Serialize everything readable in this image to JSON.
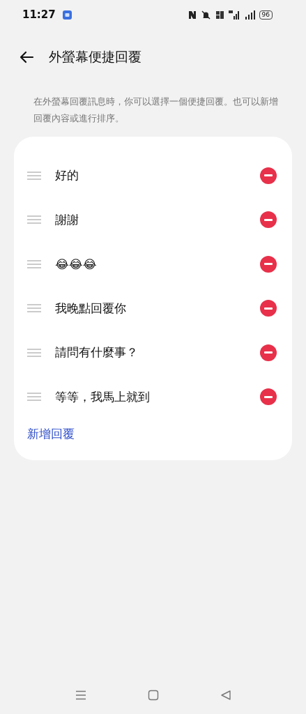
{
  "status_bar": {
    "time": "11:27",
    "battery": "96"
  },
  "header": {
    "title": "外螢幕便捷回覆"
  },
  "description": "在外螢幕回覆訊息時，你可以選擇一個便捷回覆。也可以新增回覆內容或進行排序。",
  "replies": [
    {
      "text": "好的"
    },
    {
      "text": "謝謝"
    },
    {
      "text": "😂😂😂"
    },
    {
      "text": "我晚點回覆你"
    },
    {
      "text": "請問有什麼事？"
    },
    {
      "text": "等等，我馬上就到"
    }
  ],
  "add_link": "新增回覆"
}
